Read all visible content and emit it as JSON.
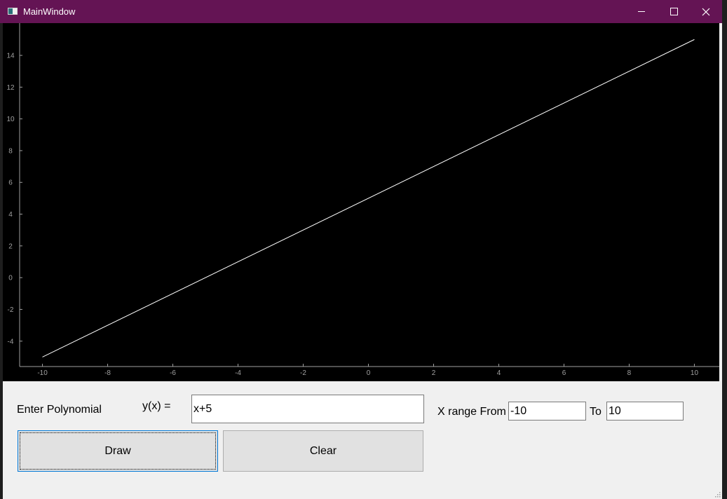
{
  "window": {
    "title": "MainWindow",
    "controls": [
      "minimize",
      "maximize",
      "close"
    ],
    "icons": {
      "minimize": "minimize-icon",
      "maximize": "maximize-icon",
      "close": "close-icon",
      "app": "app-icon"
    }
  },
  "form": {
    "polynomial_label": "Enter Polynomial",
    "yx_label": "y(x) =",
    "polynomial_value": "x+5",
    "xrange_label": "X range From",
    "from_value": "-10",
    "to_label": "To",
    "to_value": "10",
    "draw_label": "Draw",
    "clear_label": "Clear"
  },
  "chart_data": {
    "type": "line",
    "title": "",
    "xlabel": "",
    "ylabel": "",
    "xlim": [
      -10.7,
      10.7
    ],
    "ylim": [
      -5.6,
      15.9
    ],
    "xticks": [
      -10,
      -8,
      -6,
      -4,
      -2,
      0,
      2,
      4,
      6,
      8,
      10
    ],
    "yticks": [
      -4,
      -2,
      0,
      2,
      4,
      6,
      8,
      10,
      12,
      14
    ],
    "series": [
      {
        "x": [
          -10,
          10
        ],
        "y": [
          -5,
          15
        ],
        "color": "#ffffff"
      }
    ],
    "background": "#000000",
    "axis_color": "#a0a0a0",
    "grid": false
  }
}
